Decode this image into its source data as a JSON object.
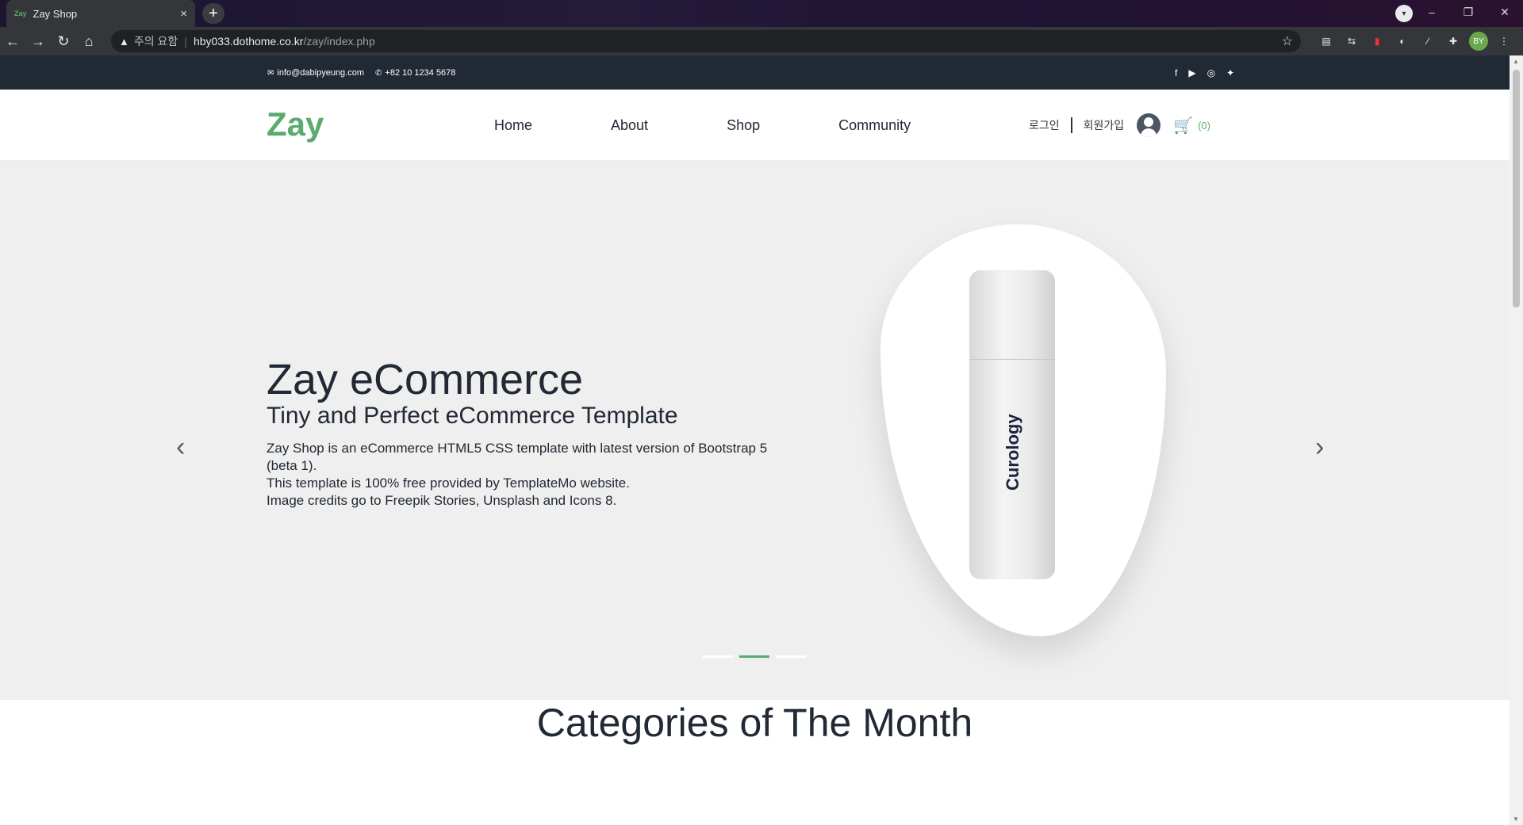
{
  "browser": {
    "tab_title": "Zay Shop",
    "tab_favicon": "Zay",
    "security_warning": "주의 요함",
    "url_host": "hby033.dothome.co.kr",
    "url_path": "/zay/index.php",
    "profile_initials": "BY"
  },
  "topinfo": {
    "email": "info@dabipyeung.com",
    "phone": "+82 10 1234 5678",
    "social": [
      "facebook",
      "youtube",
      "instagram",
      "twitter"
    ]
  },
  "header": {
    "logo": "Zay",
    "nav": [
      "Home",
      "About",
      "Shop",
      "Community"
    ],
    "login": "로그인",
    "signup": "회원가입",
    "cart_count": "(0)"
  },
  "hero": {
    "title": "Zay eCommerce",
    "subtitle": "Tiny and Perfect eCommerce Template",
    "line1": "Zay Shop is an eCommerce HTML5 CSS template with latest version of Bootstrap 5 (beta 1).",
    "line2": "This template is 100% free provided by TemplateMo website.",
    "line3": "Image credits go to Freepik Stories, Unsplash and Icons 8.",
    "product_brand": "Curology",
    "active_slide": 2,
    "slide_count": 3
  },
  "categories": {
    "title": "Categories of The Month"
  },
  "colors": {
    "accent": "#59ab6e",
    "dark": "#212934",
    "hero_bg": "#efefef"
  }
}
